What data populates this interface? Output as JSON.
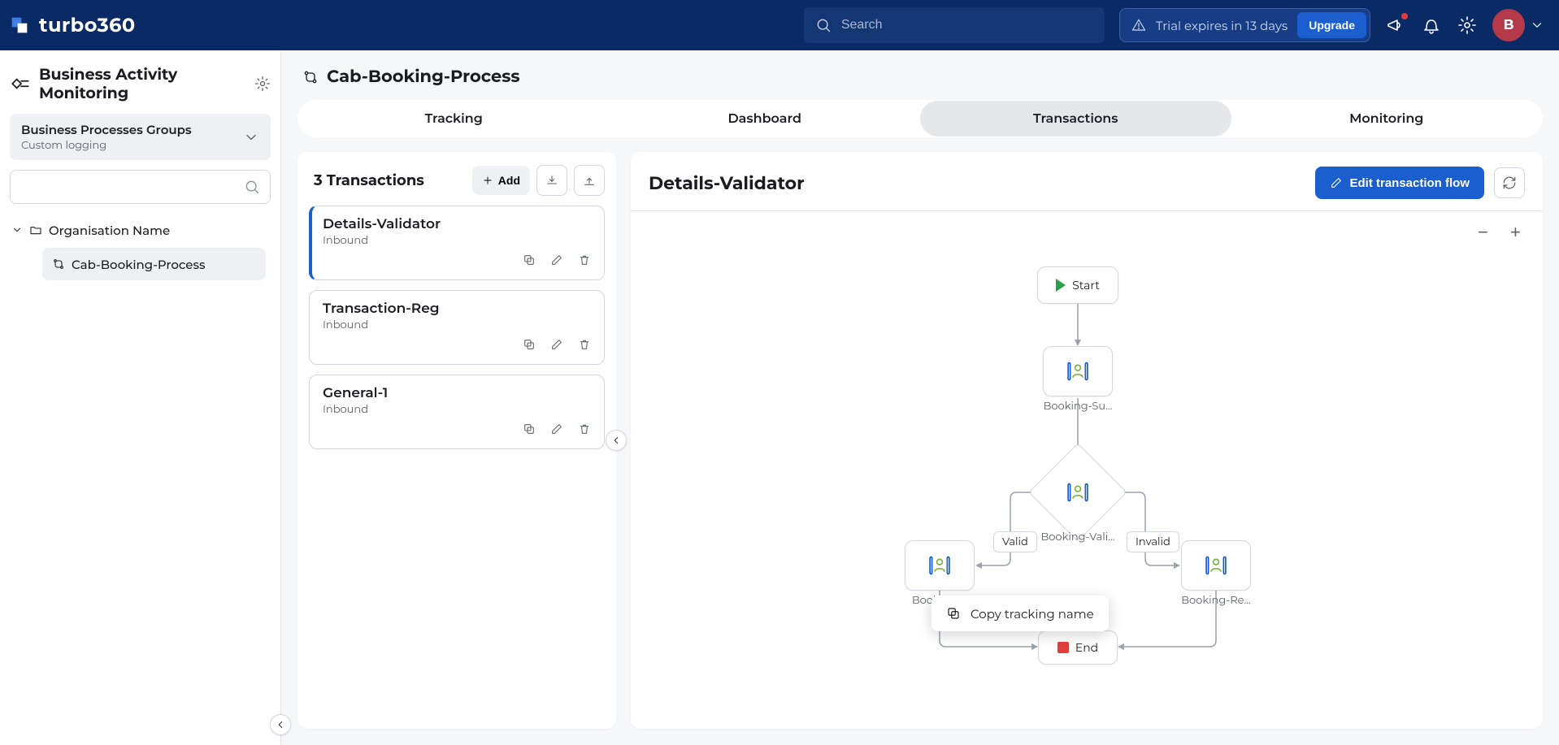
{
  "brand": "turbo360",
  "search_placeholder": "Search",
  "trial_text": "Trial expires in 13 days",
  "upgrade_label": "Upgrade",
  "avatar_initial": "B",
  "sidebar": {
    "title": "Business Activity Monitoring",
    "group_label": "Business Processes Groups",
    "group_sub": "Custom logging",
    "org_folder": "Organisation Name",
    "process_item": "Cab-Booking-Process"
  },
  "page": {
    "title": "Cab-Booking-Process",
    "tabs": [
      "Tracking",
      "Dashboard",
      "Transactions",
      "Monitoring"
    ],
    "active_tab_index": 2
  },
  "tx": {
    "count_label": "3 Transactions",
    "add_label": "Add",
    "items": [
      {
        "name": "Details-Validator",
        "direction": "Inbound"
      },
      {
        "name": "Transaction-Reg",
        "direction": "Inbound"
      },
      {
        "name": "General-1",
        "direction": "Inbound"
      }
    ]
  },
  "flow": {
    "title": "Details-Validator",
    "edit_label": "Edit transaction flow",
    "start_label": "Start",
    "end_label": "End",
    "step1_label": "Booking-Su...",
    "decision_label": "Booking-Vali...",
    "left_label": "Booking-…",
    "right_label": "Booking-Re...",
    "branch_valid": "Valid",
    "branch_invalid": "Invalid",
    "ctx_copy": "Copy tracking name"
  }
}
